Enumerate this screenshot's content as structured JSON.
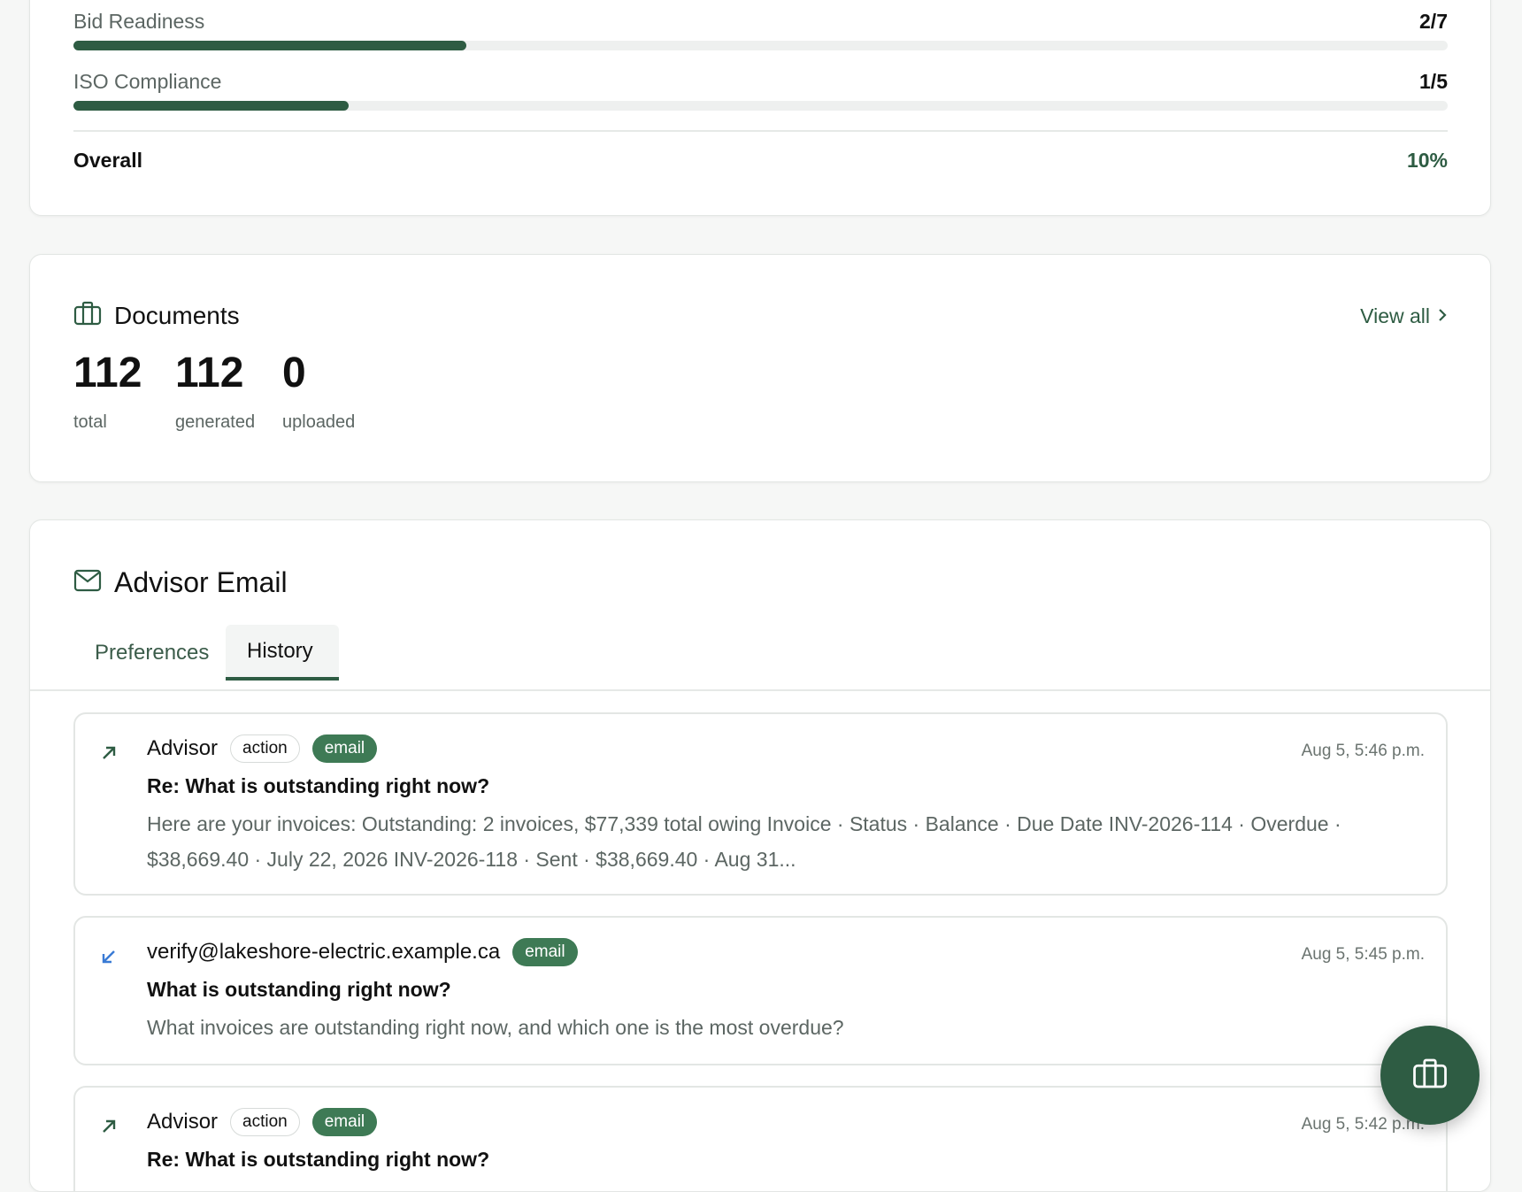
{
  "progress": {
    "items": [
      {
        "label": "Bid Readiness",
        "count": "2/7",
        "fraction": 0.2857
      },
      {
        "label": "ISO Compliance",
        "count": "1/5",
        "fraction": 0.2
      }
    ],
    "overall_label": "Overall",
    "overall_value": "10%"
  },
  "documents": {
    "title": "Documents",
    "icon": "briefcase-icon",
    "view_all": "View all",
    "stats": [
      {
        "value": "112",
        "label": "total"
      },
      {
        "value": "112",
        "label": "generated"
      },
      {
        "value": "0",
        "label": "uploaded"
      }
    ]
  },
  "advisor_email": {
    "title": "Advisor Email",
    "icon": "mail-icon",
    "tabs": [
      {
        "label": "Preferences",
        "active": false
      },
      {
        "label": "History",
        "active": true
      }
    ],
    "messages": [
      {
        "direction": "outgoing",
        "sender": "Advisor",
        "tags": [
          "action",
          "email"
        ],
        "time": "Aug 5, 5:46 p.m.",
        "subject": "Re: What is outstanding right now?",
        "body": "Here are your invoices: Outstanding: 2 invoices, $77,339 total owing Invoice · Status · Balance · Due Date INV-2026-114 · Overdue · $38,669.40 · July 22, 2026 INV-2026-118 · Sent · $38,669.40 · Aug 31..."
      },
      {
        "direction": "incoming",
        "sender": "verify@lakeshore-electric.example.ca",
        "tags": [
          "email"
        ],
        "time": "Aug 5, 5:45 p.m.",
        "subject": "What is outstanding right now?",
        "body": "What invoices are outstanding right now, and which one is the most overdue?"
      },
      {
        "direction": "outgoing",
        "sender": "Advisor",
        "tags": [
          "action",
          "email"
        ],
        "time": "Aug 5, 5:42 p.m.",
        "subject": "Re: What is outstanding right now?",
        "body": ""
      }
    ]
  },
  "colors": {
    "accent": "#2e5c43",
    "pill_green": "#3e7a55",
    "incoming_arrow": "#3a7bd5"
  },
  "fab_icon": "briefcase-icon"
}
